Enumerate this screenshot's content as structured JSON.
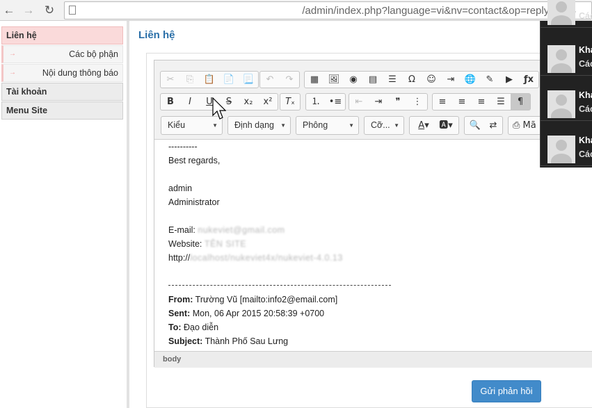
{
  "browser": {
    "url": "/admin/index.php?language=vi&nv=contact&op=reply&id=4",
    "back_glyph": "←",
    "forward_glyph": "→",
    "reload_glyph": "↻"
  },
  "sidebar": {
    "items": [
      {
        "label": "Liên hệ",
        "active": true
      },
      {
        "label": "Các bộ phận",
        "sub": true
      },
      {
        "label": "Nội dung thông báo",
        "sub": true
      },
      {
        "label": "Tài khoản"
      },
      {
        "label": "Menu Site"
      }
    ],
    "sub_arrow": "→"
  },
  "page": {
    "title": "Liên hệ"
  },
  "editor": {
    "toolbar": {
      "style_combo": "Kiểu",
      "format_combo": "Định dạng",
      "font_combo": "Phông",
      "size_combo": "Cỡ...",
      "source_label": "Mã"
    },
    "content": {
      "separator_dashes": "----------",
      "regards": "Best regards,",
      "name": "admin",
      "role": "Administrator",
      "email_label": "E-mail:",
      "email_value": "nukeviet@gmail.com",
      "website_label": "Website:",
      "website_value": "TÊN SITE",
      "http_prefix": "http://",
      "http_value": "localhost/nukeviet4x/nukeviet-4.0.13",
      "from_label": "From:",
      "from_value": "Trường Vũ [mailto:info2@email.com]",
      "sent_label": "Sent:",
      "sent_value": "Mon, 06 Apr 2015 20:58:39 +0700",
      "to_label": "To:",
      "to_value": "Đạo diễn",
      "subject_label": "Subject:",
      "subject_value": "Thành Phố Sau Lưng"
    },
    "status_path": "body"
  },
  "submit": {
    "label": "Gửi phản hồi"
  },
  "notifications": {
    "items": [
      {
        "name": "",
        "sub": "Các"
      },
      {
        "name": "Khá",
        "sub": "Các"
      },
      {
        "name": "Khá",
        "sub": "Các"
      },
      {
        "name": "Khá",
        "sub": "Các"
      }
    ]
  },
  "colors": {
    "accent": "#428bca",
    "title": "#2a6fa8",
    "active_menu": "#fadada"
  }
}
